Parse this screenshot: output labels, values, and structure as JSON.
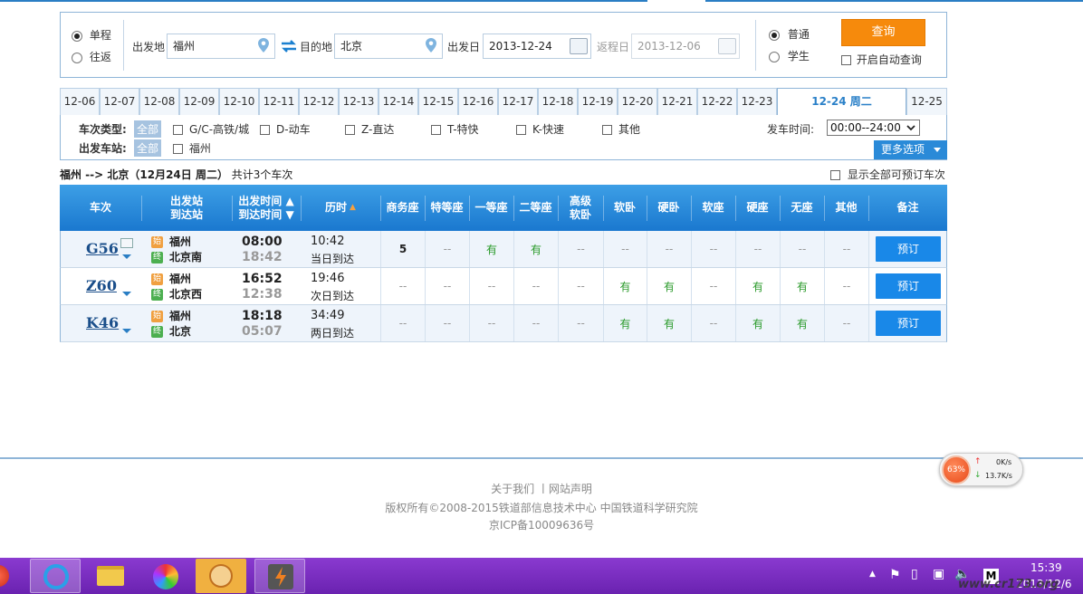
{
  "search": {
    "trip_types": [
      {
        "label": "单程",
        "checked": true
      },
      {
        "label": "往返",
        "checked": false
      }
    ],
    "from_label": "出发地",
    "from_value": "福州",
    "to_label": "目的地",
    "to_value": "北京",
    "date_label": "出发日",
    "date_value": "2013-12-24",
    "return_label": "返程日",
    "return_value": "2013-12-06",
    "ticket_types": [
      {
        "label": "普通",
        "checked": true
      },
      {
        "label": "学生",
        "checked": false
      }
    ],
    "query_label": "查询",
    "auto_query_label": "开启自动查询"
  },
  "date_tabs": [
    "12-06",
    "12-07",
    "12-08",
    "12-09",
    "12-10",
    "12-11",
    "12-12",
    "12-13",
    "12-14",
    "12-15",
    "12-16",
    "12-17",
    "12-18",
    "12-19",
    "12-20",
    "12-21",
    "12-22",
    "12-23",
    "12-24 周二",
    "12-25"
  ],
  "active_tab": "12-24 周二",
  "filter": {
    "type_label": "车次类型:",
    "all_label": "全部",
    "types": [
      "G/C-高铁/城",
      "D-动车",
      "Z-直达",
      "T-特快",
      "K-快速",
      "其他"
    ],
    "station_label": "出发车站:",
    "station_all": "全部",
    "stations": [
      "福州"
    ],
    "time_label": "发车时间:",
    "time_value": "00:00--24:00",
    "more_label": "更多选项"
  },
  "summary": {
    "route": "福州 --> 北京（12月24日  周二）",
    "count": "共计3个车次",
    "show_all_label": "显示全部可预订车次"
  },
  "table": {
    "headers": {
      "train": "车次",
      "station_top": "出发站",
      "station_bottom": "到达站",
      "time_top": "出发时间",
      "time_bottom": "到达时间",
      "duration": "历时",
      "business": "商务座",
      "special": "特等座",
      "first": "一等座",
      "second": "二等座",
      "hsoft_top": "高级",
      "hsoft_bottom": "软卧",
      "soft_sleep": "软卧",
      "hard_sleep": "硬卧",
      "soft_seat": "软座",
      "hard_seat": "硬座",
      "no_seat": "无座",
      "other": "其他",
      "note": "备注"
    },
    "start_badge": "始",
    "end_badge": "终",
    "rows": [
      {
        "train": "G56",
        "from": "福州",
        "to": "北京南",
        "dep": "08:00",
        "arr": "18:42",
        "dur": "10:42",
        "dur_text": "当日到达",
        "seats": [
          "5",
          "--",
          "有",
          "有",
          "--",
          "--",
          "--",
          "--",
          "--",
          "--",
          "--"
        ],
        "book": "预订"
      },
      {
        "train": "Z60",
        "from": "福州",
        "to": "北京西",
        "dep": "16:52",
        "arr": "12:38",
        "dur": "19:46",
        "dur_text": "次日到达",
        "seats": [
          "--",
          "--",
          "--",
          "--",
          "--",
          "有",
          "有",
          "--",
          "有",
          "有",
          "--"
        ],
        "book": "预订"
      },
      {
        "train": "K46",
        "from": "福州",
        "to": "北京",
        "dep": "18:18",
        "arr": "05:07",
        "dur": "34:49",
        "dur_text": "两日到达",
        "seats": [
          "--",
          "--",
          "--",
          "--",
          "--",
          "有",
          "有",
          "--",
          "有",
          "有",
          "--"
        ],
        "book": "预订"
      }
    ]
  },
  "footer": {
    "links": "关于我们  丨网站声明",
    "copyright": "版权所有©2008-2015铁道部信息技术中心   中国铁道科学研究院",
    "icp": "京ICP备10009636号"
  },
  "net_widget": {
    "percent": "63%",
    "up": "0K/s",
    "down": "13.7K/s"
  },
  "taskbar": {
    "time": "15:39",
    "date": "2013/12/6",
    "ime": "M"
  },
  "watermark": "www.cr173.org",
  "colors": {
    "accent": "#1988e8",
    "query": "#f68a0c",
    "yes": "#2a9a2a",
    "taskbar": "#7a2ec0"
  }
}
